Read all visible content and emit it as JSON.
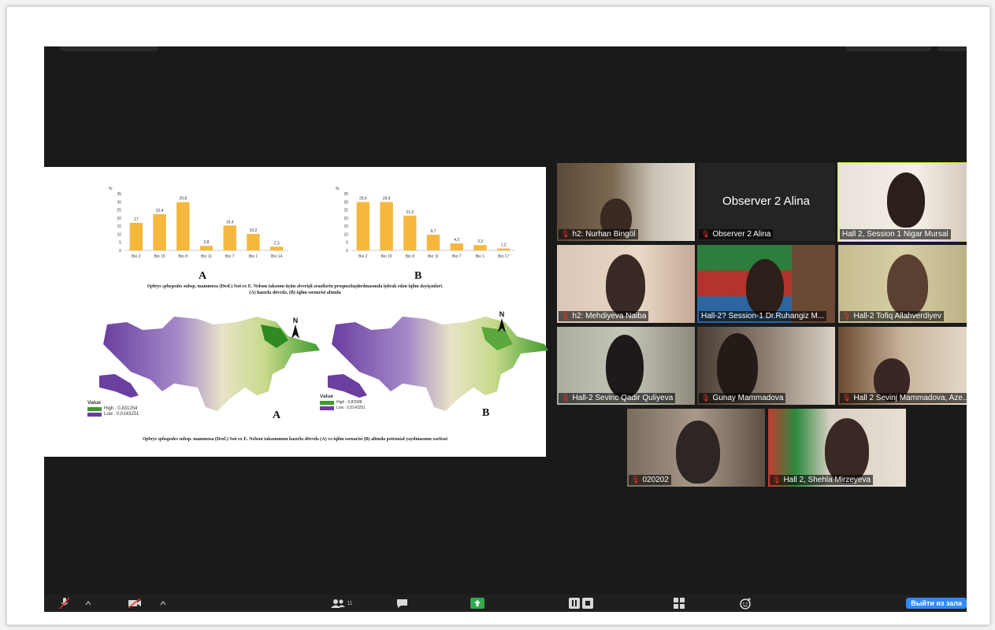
{
  "slide": {
    "chart_data": [
      {
        "type": "bar",
        "ylabel": "%",
        "ylim": [
          0,
          35
        ],
        "yticks": [
          "35",
          "30",
          "25",
          "20",
          "15",
          "10",
          "5",
          "0"
        ],
        "categories": [
          "Bio 2",
          "Bio 15",
          "Bio 8",
          "Bio 11",
          "Bio 7",
          "Bio 1",
          "Bio 14"
        ],
        "values": [
          17,
          22.4,
          29.8,
          2.8,
          15.4,
          10.2,
          2.3
        ],
        "data_labels": [
          "17",
          "22,4",
          "29,8",
          "2,8",
          "15,4",
          "10,2",
          "2,3"
        ],
        "bar_color": "#f5b83d"
      },
      {
        "type": "bar",
        "ylabel": "%",
        "ylim": [
          0,
          35
        ],
        "yticks": [
          "35",
          "30",
          "25",
          "20",
          "15",
          "10",
          "5",
          "0"
        ],
        "categories": [
          "Bio 2",
          "Bio 15",
          "Bio 8",
          "Bio 11",
          "Bio 7",
          "Bio 1",
          "Bio 17"
        ],
        "values": [
          29.9,
          29.9,
          21.5,
          9.7,
          4.3,
          3.3,
          1.2
        ],
        "data_labels": [
          "29,9",
          "29,9",
          "21,5",
          "9,7",
          "4,3",
          "3,3",
          "1,2"
        ],
        "bar_color": "#f5b83d"
      }
    ],
    "label_a": "A",
    "label_b": "B",
    "caption1_italic": "Ophrys sphegodes",
    "caption1_rest": " subsp. mammosa (Desf.) Soó ex E. Nelson taksonu üçün əlverişli ərazilərin proqnozlaşdırılmasında iştirak edən iqlim dəyişənləri.",
    "caption1_line2": "(A) hazırkı dövrdə, (B) iqlim ssenarisi altında",
    "map_a_label": "A",
    "map_b_label": "B",
    "north": "N",
    "legend_title": "Value",
    "legend_high_a": "High : 0,831254",
    "legend_low_a": "Low : 0,0143251",
    "legend_high_b": "High : 0,82088",
    "legend_low_b": "Low : 0,0143251",
    "caption2_italic": "Ophrys sphegodes",
    "caption2_rest": " subsp. mammosa (Desf.) Soó ex E. Nelson taksonunun hazırkı dövrdə (A) və iqlim ssenarisi (B) altında potensial yayılmasının xəritəsi"
  },
  "participants": [
    {
      "name": "h2: Nurhan Bingöl"
    },
    {
      "name": "Observer 2 Alina",
      "display_text": "Observer 2 Alina"
    },
    {
      "name": "Hall 2, Session 1 Nigar Mursal"
    },
    {
      "name": "h2: Mehdiyeva Naiba"
    },
    {
      "name": "Hall-2? Session-1 Dr.Ruhangiz M..."
    },
    {
      "name": "Hall-2 Tofiq Allahverdiyev"
    },
    {
      "name": "Hall-2 Sevinc Qadir Quliyeva"
    },
    {
      "name": "Gunay Mammadova"
    },
    {
      "name": "Hall 2 Sevinj Mammadova, Aze..."
    },
    {
      "name": "020202"
    },
    {
      "name": "Hall 2, Shehla Mirzeyeva"
    }
  ],
  "toolbar": {
    "participants_count": "11",
    "leave_label": "Выйти из зала"
  },
  "colors": {
    "accent_active_speaker": "#c9e04a",
    "share_green": "#2ea94b",
    "leave_blue": "#2d8cff",
    "muted_red": "#e5332a"
  }
}
